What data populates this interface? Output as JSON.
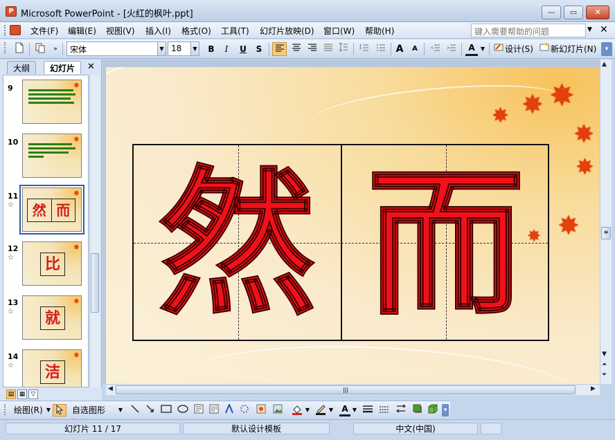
{
  "window": {
    "title": "Microsoft PowerPoint - [火红的枫叶.ppt]",
    "min": "—",
    "max": "▭",
    "close": "✕"
  },
  "menu": {
    "items": [
      "文件(F)",
      "编辑(E)",
      "视图(V)",
      "插入(I)",
      "格式(O)",
      "工具(T)",
      "幻灯片放映(D)",
      "窗口(W)",
      "帮助(H)"
    ],
    "help_placeholder": "键入需要帮助的问题",
    "close": "✕"
  },
  "toolbar": {
    "font_name": "宋体",
    "font_size": "18",
    "bold": "B",
    "italic": "I",
    "underline": "U",
    "shadow": "S",
    "font_grow": "A",
    "font_shrink": "A",
    "font_color": "A",
    "design_label": "设计(S)",
    "new_slide_label": "新幻灯片(N)"
  },
  "pane": {
    "tabs": [
      "大纲",
      "幻灯片"
    ],
    "close": "✕",
    "thumbnails": [
      {
        "num": "9",
        "kind": "text"
      },
      {
        "num": "10",
        "kind": "text"
      },
      {
        "num": "11",
        "kind": "chars",
        "chars": [
          "然",
          "而"
        ],
        "selected": true,
        "star": "☆"
      },
      {
        "num": "12",
        "kind": "chars",
        "chars": [
          "比"
        ],
        "star": "☆"
      },
      {
        "num": "13",
        "kind": "chars",
        "chars": [
          "就"
        ],
        "star": "☆"
      },
      {
        "num": "14",
        "kind": "chars",
        "chars": [
          "洁"
        ],
        "star": "☆"
      }
    ]
  },
  "slide": {
    "chars": [
      "然",
      "而"
    ]
  },
  "drawing": {
    "draw_label": "绘图(R)",
    "autoshapes_label": "自选图形(U)"
  },
  "status": {
    "slide_info": "幻灯片 11 / 17",
    "template": "默认设计模板",
    "language": "中文(中国)"
  },
  "colors": {
    "accent_orange": "#f8c97e",
    "char_red": "#f2111a",
    "leaf_red": "#e2400e"
  }
}
